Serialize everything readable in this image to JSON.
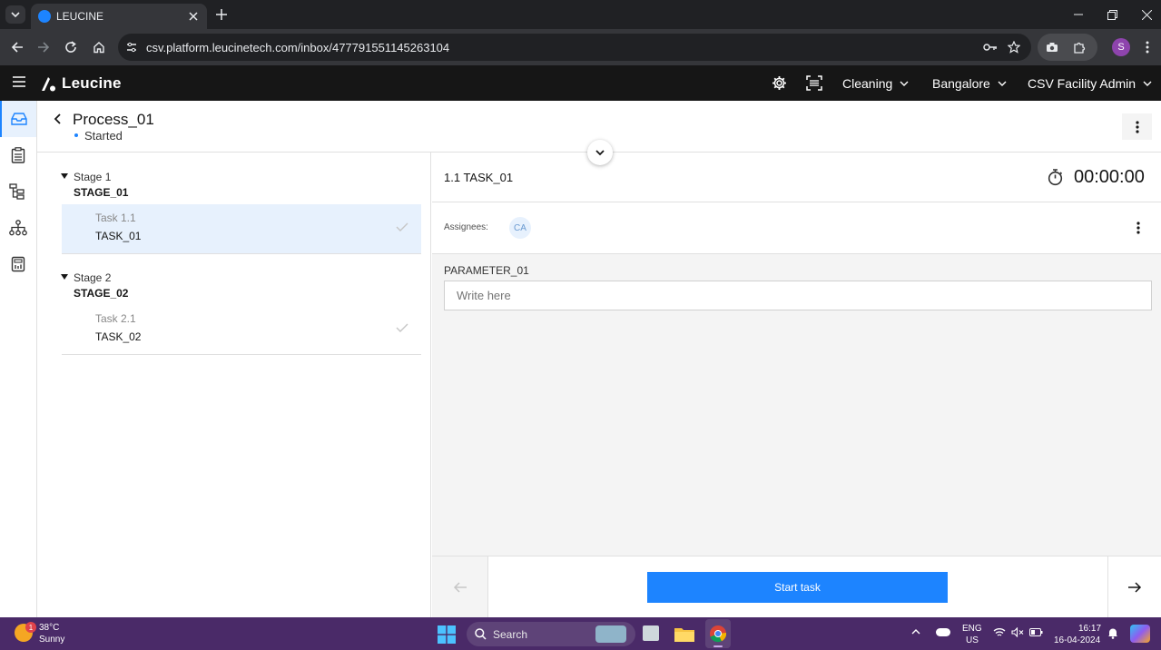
{
  "browser": {
    "tab_title": "LEUCINE",
    "url": "csv.platform.leucinetech.com/inbox/477791551145263104",
    "profile_initial": "S"
  },
  "header": {
    "brand": "Leucine",
    "use_case": "Cleaning",
    "facility": "Bangalore",
    "role": "CSV Facility Admin"
  },
  "process": {
    "name": "Process_01",
    "status": "Started"
  },
  "stages": [
    {
      "label": "Stage 1",
      "name": "STAGE_01",
      "tasks": [
        {
          "label": "Task 1.1",
          "name": "TASK_01",
          "selected": true
        }
      ]
    },
    {
      "label": "Stage 2",
      "name": "STAGE_02",
      "tasks": [
        {
          "label": "Task 2.1",
          "name": "TASK_02",
          "selected": false
        }
      ]
    }
  ],
  "task": {
    "title": "1.1 TASK_01",
    "timer": "00:00:00",
    "assignees_label": "Assignees:",
    "assignee_initials": "CA",
    "parameter_label": "PARAMETER_01",
    "parameter_placeholder": "Write here",
    "start_button": "Start task"
  },
  "taskbar": {
    "weather_temp": "38°C",
    "weather_desc": "Sunny",
    "weather_badge": "1",
    "search_label": "Search",
    "lang_line1": "ENG",
    "lang_line2": "US",
    "time": "16:17",
    "date": "16-04-2024"
  },
  "colors": {
    "primary": "#1d84ff",
    "header_bg": "#161616",
    "selected_task_bg": "#e7f1fd",
    "status_dot": "#1d84ff",
    "taskbar_bg": "#4a2a68"
  }
}
